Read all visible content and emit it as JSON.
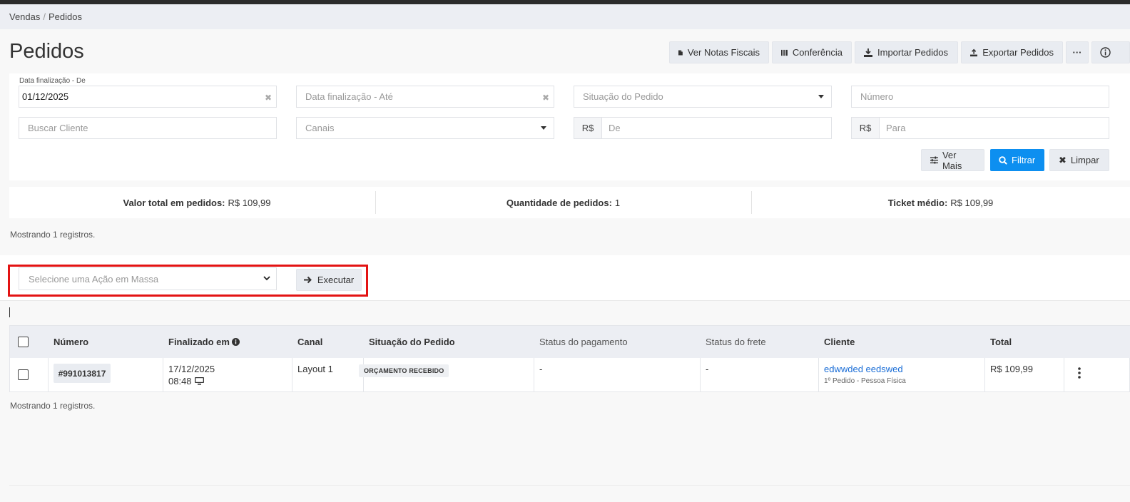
{
  "breadcrumb": {
    "items": [
      "Vendas",
      "Pedidos"
    ]
  },
  "page": {
    "title": "Pedidos"
  },
  "toolbar": {
    "ver_notas": "Ver Notas Fiscais",
    "conferencia": "Conferência",
    "importar": "Importar Pedidos",
    "exportar": "Exportar Pedidos",
    "more": "···"
  },
  "filters": {
    "date_from_label": "Data finalização - De",
    "date_from_value": "01/12/2025",
    "date_to_placeholder": "Data finalização - Até",
    "situacao_placeholder": "Situação do Pedido",
    "numero_placeholder": "Número",
    "cliente_placeholder": "Buscar Cliente",
    "canais_placeholder": "Canais",
    "currency": "R$",
    "valor_de_placeholder": "De",
    "valor_para_placeholder": "Para",
    "ver_mais": "Ver Mais",
    "filtrar": "Filtrar",
    "limpar": "Limpar"
  },
  "stats": {
    "total_label": "Valor total em pedidos:",
    "total_value": "R$ 109,99",
    "qty_label": "Quantidade de pedidos:",
    "qty_value": "1",
    "ticket_label": "Ticket médio:",
    "ticket_value": "R$ 109,99"
  },
  "showing_text": "Mostrando 1 registros.",
  "bulk": {
    "placeholder": "Selecione uma Ação em Massa",
    "execute": "Executar"
  },
  "table": {
    "headers": {
      "numero": "Número",
      "finalizado": "Finalizado em",
      "canal": "Canal",
      "situacao": "Situação do Pedido",
      "pagamento": "Status do pagamento",
      "frete": "Status do frete",
      "cliente": "Cliente",
      "total": "Total"
    },
    "rows": [
      {
        "numero": "#991013817",
        "date": "17/12/2025",
        "time": "08:48",
        "canal": "Layout 1",
        "situacao": "ORÇAMENTO RECEBIDO",
        "pagamento": "-",
        "frete": "-",
        "cliente": "edwwded eedswed",
        "cliente_sub": "1º Pedido - Pessoa Física",
        "total": "R$ 109,99"
      }
    ]
  },
  "colors": {
    "primary": "#0d8ff0",
    "highlight": "#e31313",
    "link": "#1a6dd6"
  }
}
